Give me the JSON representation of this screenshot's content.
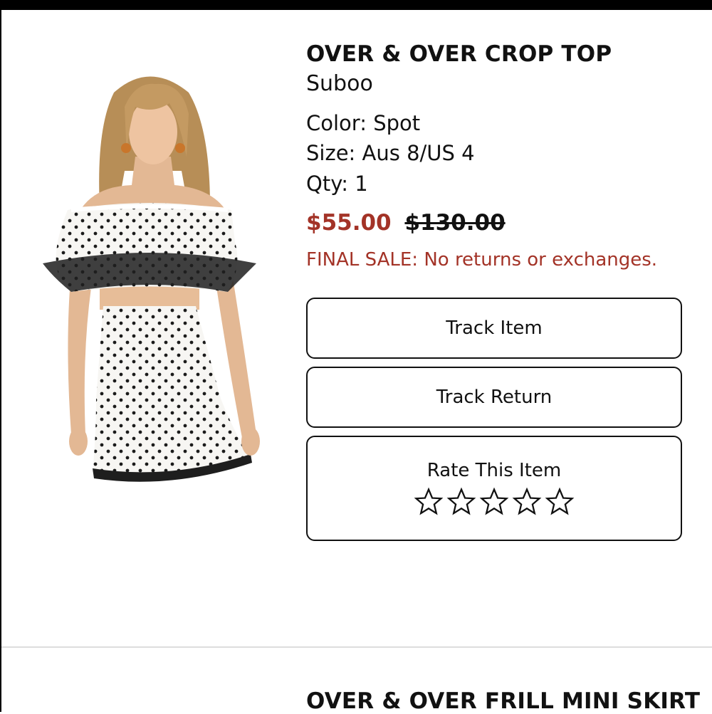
{
  "item1": {
    "title": "OVER & OVER CROP TOP",
    "brand": "Suboo",
    "color": "Color: Spot",
    "size": "Size: Aus 8/US 4",
    "qty": "Qty: 1",
    "sale_price": "$55.00",
    "original_price": "$130.00",
    "final_sale_note": "FINAL SALE: No returns or exchanges.",
    "buttons": {
      "track_item": "Track Item",
      "track_return": "Track Return",
      "rate_item": "Rate This Item"
    },
    "rating": {
      "stars_total": 5,
      "stars_filled": 0
    },
    "image_icon": "product-photo-polka-dot-crop-top-and-skirt"
  },
  "item2": {
    "title": "OVER & OVER FRILL MINI SKIRT"
  },
  "colors": {
    "sale_red": "#a33327",
    "text": "#111111",
    "border": "#111111",
    "divider": "#dddddd"
  }
}
